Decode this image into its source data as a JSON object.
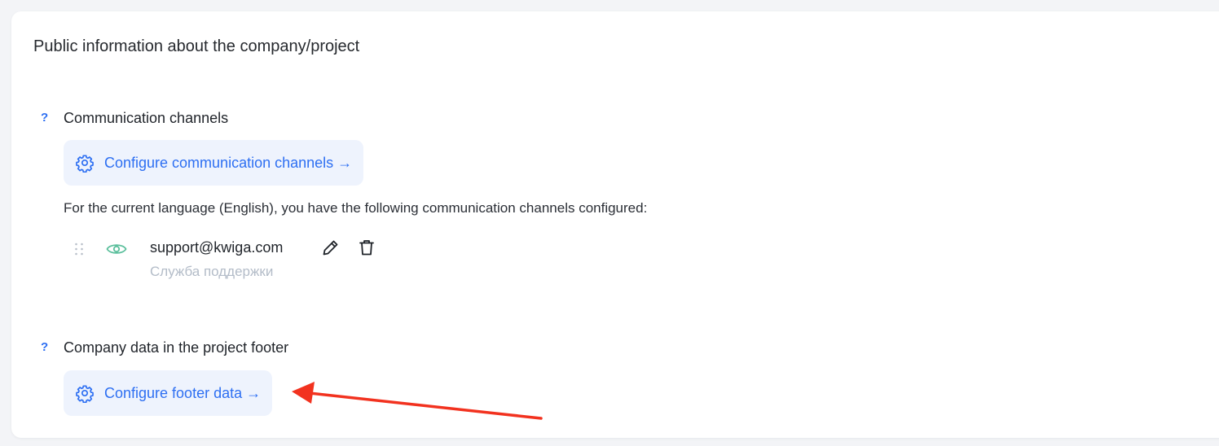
{
  "card": {
    "title": "Public information about the company/project"
  },
  "communication": {
    "help_mark": "?",
    "title": "Communication channels",
    "config_button_label": "Configure communication channels →",
    "description": "For the current language (English), you have the following communication channels configured:",
    "channels": [
      {
        "value": "support@kwiga.com",
        "label": "Служба поддержки",
        "visible_icon": "eye-icon"
      }
    ]
  },
  "footer": {
    "help_mark": "?",
    "title": "Company data in the project footer",
    "config_button_label": "Configure footer data →"
  },
  "colors": {
    "accent": "#2d6ff2",
    "button_bg": "#eef3fd",
    "eye": "#5bbf9c",
    "muted_label": "#b3bcc8",
    "annotation_arrow": "#f2321f"
  },
  "icons": {
    "config_button": "gear-icon",
    "drag": "drag-handle-icon",
    "edit": "pencil-icon",
    "delete": "trash-icon"
  }
}
